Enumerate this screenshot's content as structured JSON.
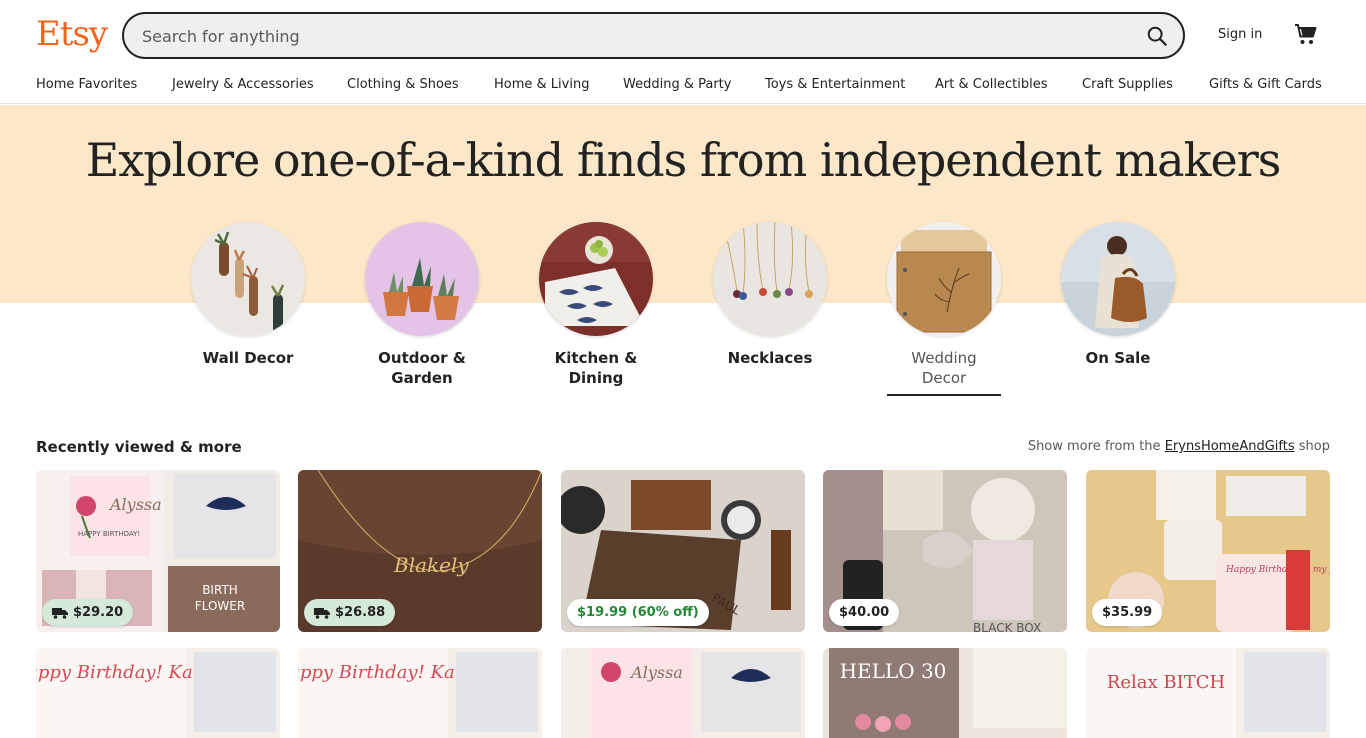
{
  "header": {
    "logo": "Etsy",
    "search_placeholder": "Search for anything",
    "search_value": "",
    "signin": "Sign in"
  },
  "nav": [
    "Home Favorites",
    "Jewelry & Accessories",
    "Clothing & Shoes",
    "Home & Living",
    "Wedding & Party",
    "Toys & Entertainment",
    "Art & Collectibles",
    "Craft Supplies",
    "Gifts & Gift Cards"
  ],
  "hero": {
    "title": "Explore one-of-a-kind finds from independent makers",
    "categories": [
      {
        "line1": "Wall Decor",
        "line2": ""
      },
      {
        "line1": "Outdoor &",
        "line2": "Garden"
      },
      {
        "line1": "Kitchen &",
        "line2": "Dining"
      },
      {
        "line1": "Necklaces",
        "line2": ""
      },
      {
        "line1": "Wedding",
        "line2": "Decor"
      },
      {
        "line1": "On Sale",
        "line2": ""
      }
    ]
  },
  "recent": {
    "title": "Recently viewed & more",
    "more_prefix": "Show more from the ",
    "shop_name": "ErynsHomeAndGifts",
    "more_suffix": " shop",
    "products": [
      {
        "price": "$29.20",
        "free_shipping": true,
        "sale": false,
        "art_texts": [
          "Alyssa",
          "HAPPY BIRTHDAY!",
          "BIRTH",
          "FLOWER"
        ]
      },
      {
        "price": "$26.88",
        "free_shipping": true,
        "sale": false,
        "art_texts": [
          "Blakely"
        ]
      },
      {
        "price": "$19.99 (60% off)",
        "free_shipping": false,
        "sale": true,
        "art_texts": [
          "PAUL"
        ]
      },
      {
        "price": "$40.00",
        "free_shipping": false,
        "sale": false,
        "art_texts": [
          "BLACK BOX"
        ]
      },
      {
        "price": "$35.99",
        "free_shipping": false,
        "sale": false,
        "art_texts": [
          "Happy Birthday to my forever"
        ]
      }
    ],
    "row2_art_texts": [
      "Happy Birthday! Kate",
      "Happy Birthday! Kate",
      "Alyssa",
      "HELLO 30",
      "Relax BITCH"
    ]
  },
  "colors": {
    "brand": "#f1641e",
    "hero_bg": "#fce8c8",
    "shipping_badge": "#d4e9d7",
    "sale_green": "#258635"
  }
}
